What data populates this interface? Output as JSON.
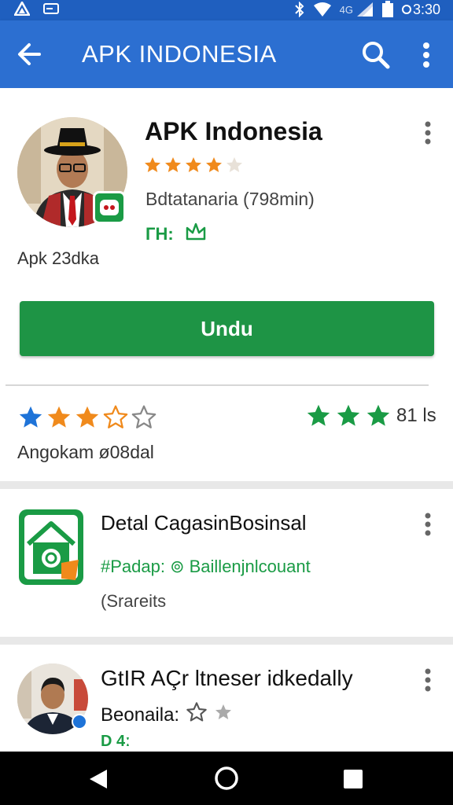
{
  "status_bar": {
    "time": "3:30",
    "network": "4G"
  },
  "app_bar": {
    "title": "APK INDONESIA"
  },
  "hero": {
    "title": "APK Indonesia",
    "rating_stars": 4,
    "subtitle": "Bdtatanaria (798min)",
    "tag": "ГН:",
    "meta": "Apk 23dka"
  },
  "install_button": {
    "label": "Undu"
  },
  "ratings": {
    "left_stars": 3,
    "left_stars_max": 5,
    "right_stars": 3,
    "count": "81 ls",
    "label": "Angokam ø08dal"
  },
  "list_item": {
    "title": "Detal CaɡasinBosinsal",
    "tag": "#Padap: ⊚ Baillenjnlcouant",
    "subtitle": "(Sraɾeits"
  },
  "profile_item": {
    "title": "GtIR AÇr ltneser idkedally",
    "subtitle": "Beonaila:",
    "tag": "D 4ː"
  },
  "colors": {
    "status_bar": "#1f5fbf",
    "app_bar": "#2c6fd1",
    "primary_green": "#1e9445",
    "star_orange": "#f08a1c",
    "star_blue": "#1e73d8",
    "star_green": "#1a9b45"
  }
}
